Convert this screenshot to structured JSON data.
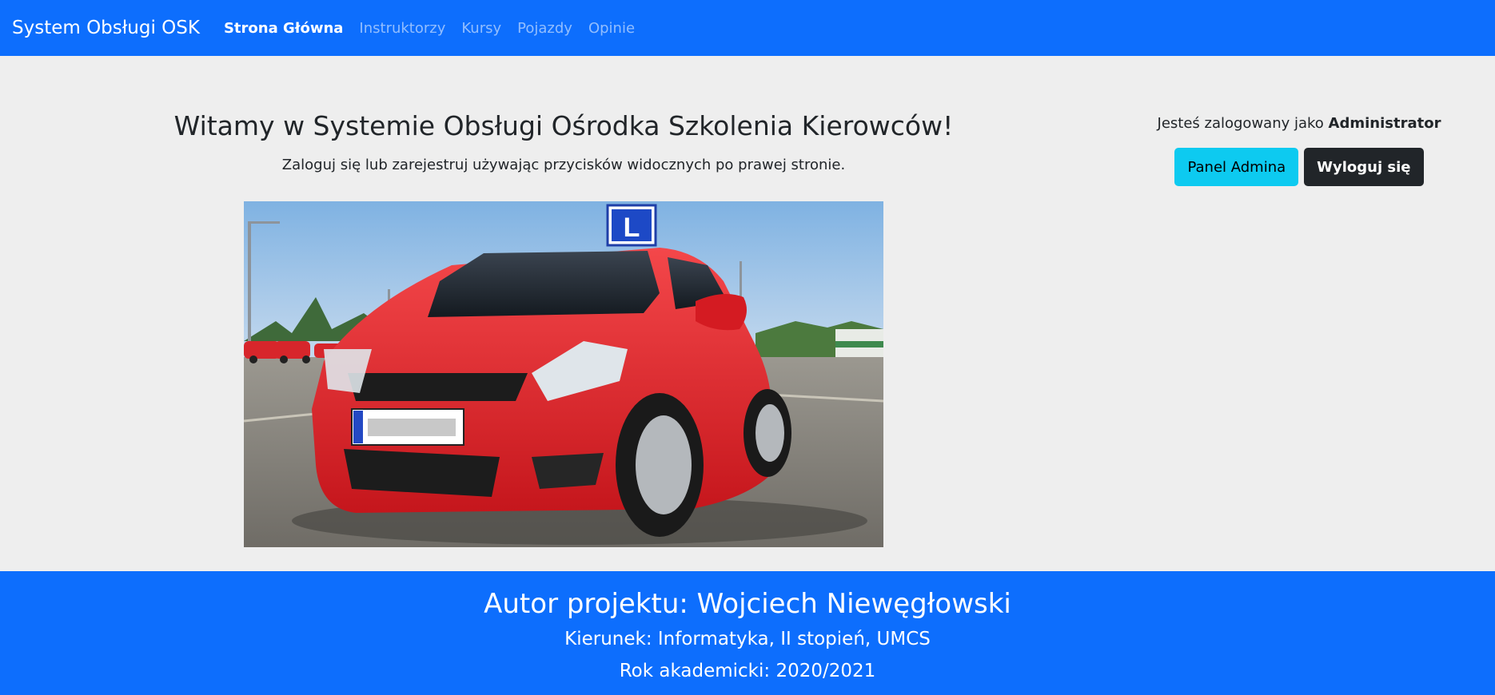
{
  "navbar": {
    "brand": "System Obsługi OSK",
    "links": [
      {
        "label": "Strona Główna",
        "active": true
      },
      {
        "label": "Instruktorzy",
        "active": false
      },
      {
        "label": "Kursy",
        "active": false
      },
      {
        "label": "Pojazdy",
        "active": false
      },
      {
        "label": "Opinie",
        "active": false
      }
    ]
  },
  "main": {
    "title": "Witamy w Systemie Obsługi Ośrodka Szkolenia Kierowców!",
    "subtitle": "Zaloguj się lub zarejestruj używając przycisków widocznych po prawej stronie.",
    "hero_sign_letter": "L"
  },
  "account": {
    "logged_prefix": "Jesteś zalogowany jako",
    "role": "Administrator",
    "admin_button": "Panel Admina",
    "logout_button": "Wyloguj się"
  },
  "footer": {
    "author": "Autor projektu: Wojciech Niewęgłowski",
    "major": "Kierunek: Informatyka, II stopień, UMCS",
    "year": "Rok akademicki: 2020/2021"
  },
  "colors": {
    "primary": "#0d6efd",
    "background": "#eeeeee",
    "admin_button": "#0dcaf0",
    "logout_button": "#212529",
    "car": "#e8262b"
  }
}
